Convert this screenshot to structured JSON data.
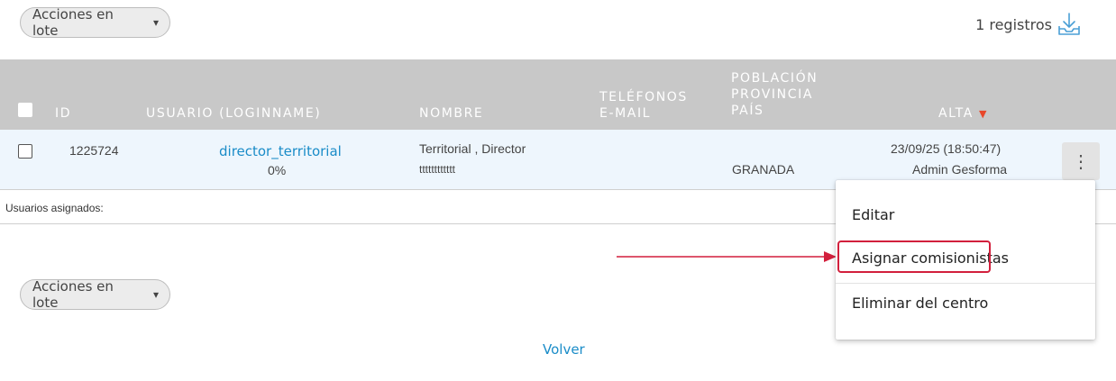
{
  "batch_actions": {
    "label": "Acciones en lote"
  },
  "records": {
    "count_label": "1 registros",
    "icon": "download-icon"
  },
  "table": {
    "headers": {
      "id": "ID",
      "user": "USUARIO (LOGINNAME)",
      "name": "NOMBRE",
      "phones": "TELÉFONOS",
      "email": "E-MAIL",
      "population": "POBLACIÓN",
      "province": "PROVINCIA",
      "country": "PAÍS",
      "alta": "ALTA",
      "sort_indicator": "▼"
    },
    "rows": [
      {
        "id": "1225724",
        "login": "director_territorial",
        "percent": "0%",
        "name": "Territorial , Director",
        "name_sub": "tttttttttttt",
        "location": "GRANADA",
        "alta_date": "23/09/25 (18:50:47)",
        "alta_by": "Admin Gesforma"
      }
    ]
  },
  "assigned": {
    "label": "Usuarios asignados:"
  },
  "context_menu": {
    "items": [
      "Editar",
      "Asignar comisionistas",
      "Eliminar del centro"
    ]
  },
  "footer": {
    "back_label": "Volver"
  },
  "colors": {
    "header_bg": "#c8c8c8",
    "row_bg": "#eef6fd",
    "link": "#1a8cc8",
    "sort_arrow": "#e8472a",
    "highlight_border": "#d21f3c"
  }
}
